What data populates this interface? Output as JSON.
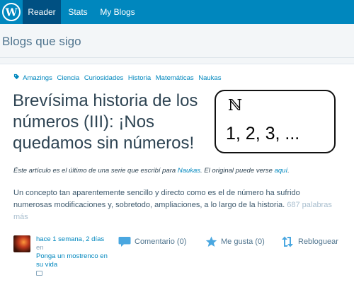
{
  "topbar": {
    "logo_icon": "wordpress-logo-icon",
    "nav": [
      {
        "label": "Reader",
        "active": true
      },
      {
        "label": "Stats",
        "active": false
      },
      {
        "label": "My Blogs",
        "active": false
      }
    ]
  },
  "page": {
    "title": "Blogs que sigo"
  },
  "post": {
    "tags": [
      "Amazings",
      "Ciencia",
      "Curiosidades",
      "Historia",
      "Matemáticas",
      "Naukas"
    ],
    "title": "Brevísima historia de los números (III): ¡Nos quedamos sin números!",
    "thumbnail": {
      "symbol": "ℕ",
      "sequence": "1, 2, 3, ..."
    },
    "intro": {
      "before": "Éste artículo es el último de una serie que escribí  para ",
      "link1": "Naukas",
      "middle": ". El original puede verse ",
      "link2": "aquí",
      "after": "."
    },
    "excerpt": "Un concepto tan aparentemente sencillo y directo como es el de número ha sufrido numerosas modificaciones y, sobretodo, ampliaciones, a lo largo de la historia.",
    "word_count": "687 palabras más",
    "meta": {
      "time": "hace 1 semana, 2 días",
      "in_label": "en",
      "blog_name": "Ponga un mostrenco en su vida"
    },
    "actions": {
      "comment": "Comentario (0)",
      "like": "Me gusta (0)",
      "reblog": "Rebloguear"
    }
  },
  "colors": {
    "topbar": "#0087be",
    "topbar_active": "#005082",
    "link": "#0087be",
    "text": "#2e4453",
    "action_icon": "#4aa7e0"
  }
}
